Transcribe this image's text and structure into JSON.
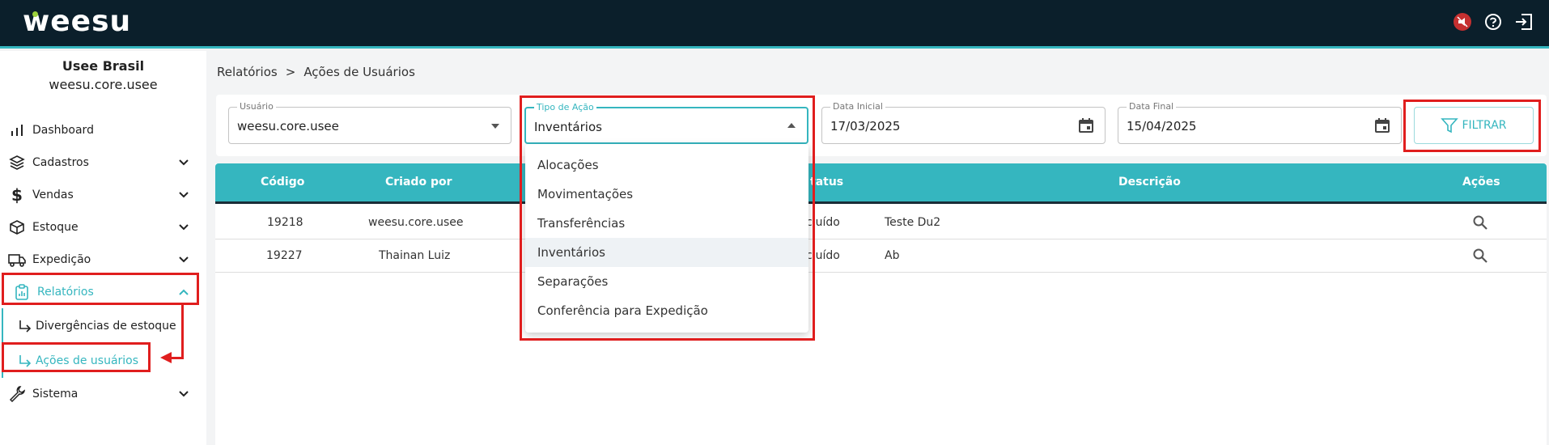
{
  "header": {
    "logo_text": "weesu",
    "icons": [
      "megaphone-off-icon",
      "help-icon",
      "logout-icon"
    ]
  },
  "sidebar": {
    "company_name": "Usee Brasil",
    "company_user": "weesu.core.usee",
    "items": [
      {
        "label": "Dashboard",
        "icon": "bar-chart-icon"
      },
      {
        "label": "Cadastros",
        "icon": "layers-icon"
      },
      {
        "label": "Vendas",
        "icon": "dollar-icon"
      },
      {
        "label": "Estoque",
        "icon": "box-icon"
      },
      {
        "label": "Expedição",
        "icon": "truck-icon"
      },
      {
        "label": "Relatórios",
        "icon": "clipboard-icon"
      },
      {
        "label": "Sistema",
        "icon": "wrench-icon"
      }
    ],
    "sub_items": [
      {
        "label": "Divergências de estoque"
      },
      {
        "label": "Ações de usuários"
      }
    ]
  },
  "breadcrumb": {
    "root": "Relatórios",
    "separator": ">",
    "current": "Ações de Usuários"
  },
  "filters": {
    "usuario": {
      "label": "Usuário",
      "value": "weesu.core.usee"
    },
    "tipo_acao": {
      "label": "Tipo de Ação",
      "value": "Inventários"
    },
    "data_inicial": {
      "label": "Data Inicial",
      "value": "17/03/2025"
    },
    "data_final": {
      "label": "Data Final",
      "value": "15/04/2025"
    },
    "filter_button": "FILTRAR"
  },
  "table": {
    "headers": [
      "Código",
      "Criado por",
      "tatus",
      "Descrição",
      "Ações"
    ],
    "rows": [
      {
        "codigo": "19218",
        "criado_por": "weesu.core.usee",
        "status": "cluído",
        "descricao": "Teste Du2"
      },
      {
        "codigo": "19227",
        "criado_por": "Thainan Luiz",
        "status": "cluído",
        "descricao": "Ab"
      }
    ]
  },
  "dropdown": {
    "options": [
      "Alocações",
      "Movimentações",
      "Transferências",
      "Inventários",
      "Separações",
      "Conferência para Expedição"
    ],
    "selected": "Inventários"
  },
  "colors": {
    "topbar": "#0b1f2b",
    "accent": "#35b6bf",
    "annotation": "#e01e1e"
  }
}
